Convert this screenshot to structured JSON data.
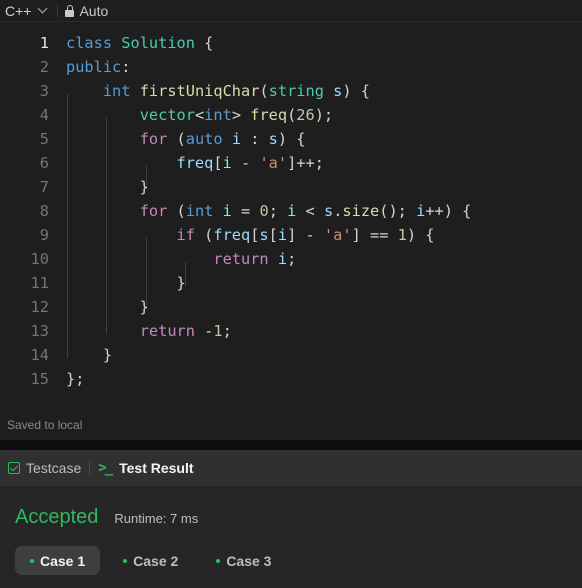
{
  "toolbar": {
    "language": "C++",
    "mode": "Auto"
  },
  "editor": {
    "lines": [
      {
        "n": "1"
      },
      {
        "n": "2"
      },
      {
        "n": "3"
      },
      {
        "n": "4"
      },
      {
        "n": "5"
      },
      {
        "n": "6"
      },
      {
        "n": "7"
      },
      {
        "n": "8"
      },
      {
        "n": "9"
      },
      {
        "n": "10"
      },
      {
        "n": "11"
      },
      {
        "n": "12"
      },
      {
        "n": "13"
      },
      {
        "n": "14"
      },
      {
        "n": "15"
      }
    ],
    "code": [
      "class Solution {",
      "public:",
      "    int firstUniqChar(string s) {",
      "        vector<int> freq(26);",
      "        for (auto i : s) {",
      "            freq[i - 'a']++;",
      "        }",
      "        for (int i = 0; i < s.size(); i++) {",
      "            if (freq[s[i] - 'a'] == 1) {",
      "                return i;",
      "            }",
      "        }",
      "        return -1;",
      "    }",
      "};"
    ]
  },
  "status": {
    "saved": "Saved to local"
  },
  "bottom": {
    "tabs": {
      "testcase": "Testcase",
      "test_result": "Test Result"
    },
    "result": {
      "verdict": "Accepted",
      "runtime": "Runtime: 7 ms"
    },
    "cases": [
      "Case 1",
      "Case 2",
      "Case 3"
    ]
  },
  "colors": {
    "accepted": "#2cbb5d",
    "keyword": "#569cd6",
    "control": "#c586c0",
    "type": "#4ec9b0",
    "function": "#dcdcaa",
    "number": "#b5cea8",
    "string": "#ce9178"
  }
}
